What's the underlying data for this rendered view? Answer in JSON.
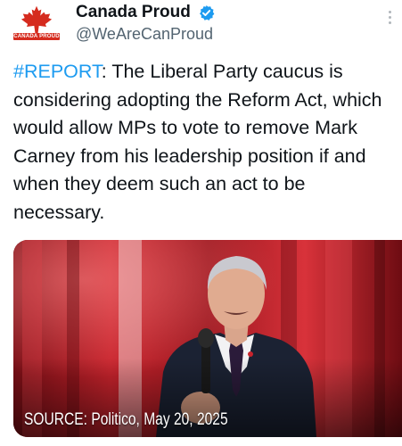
{
  "colors": {
    "link": "#1d9bf0",
    "secondary_text": "#536471",
    "verified": "#1d9bf0",
    "brand_red": "#d52b1e"
  },
  "account": {
    "avatar_icon": "maple-leaf-icon",
    "avatar_wordmark": "CANADA PROUD",
    "display_name": "Canada Proud",
    "verified_icon": "verified-badge-icon",
    "handle": "@WeAreCanProud"
  },
  "header": {
    "more_icon": "more-vertical-icon"
  },
  "tweet": {
    "hashtag": "#REPORT",
    "body": ": The Liberal Party caucus is considering adopting the Reform Act, which would allow MPs to vote to remove Mark Carney from his leadership position if and when they deem such an act to be necessary."
  },
  "media": {
    "caption": "SOURCE: Politico, May 20, 2025"
  }
}
